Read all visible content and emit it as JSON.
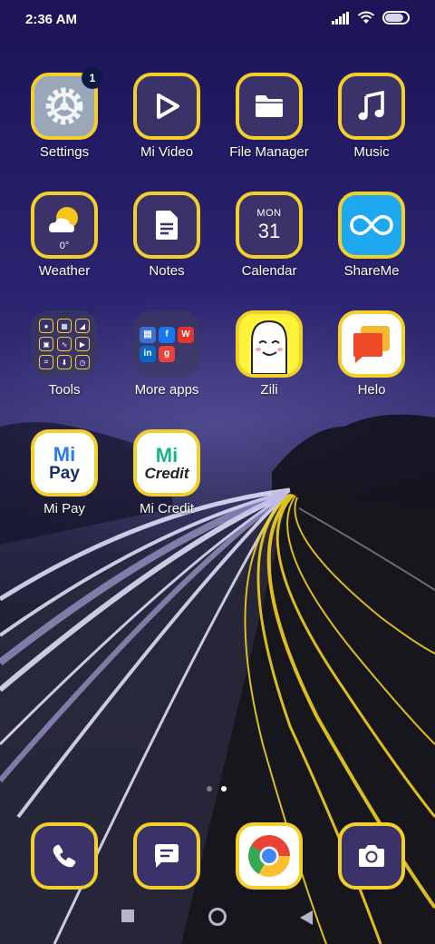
{
  "status_bar": {
    "time": "2:36 AM",
    "battery_level": 0.85
  },
  "apps": {
    "settings": {
      "label": "Settings",
      "badge": "1"
    },
    "mi_video": {
      "label": "Mi Video"
    },
    "file_manager": {
      "label": "File Manager"
    },
    "music": {
      "label": "Music"
    },
    "weather": {
      "label": "Weather",
      "temp": "0°"
    },
    "notes": {
      "label": "Notes"
    },
    "calendar": {
      "label": "Calendar",
      "month": "MON",
      "day": "31"
    },
    "shareme": {
      "label": "ShareMe"
    },
    "tools": {
      "label": "Tools"
    },
    "more_apps": {
      "label": "More apps"
    },
    "zili": {
      "label": "Zili"
    },
    "helo": {
      "label": "Helo"
    },
    "mi_pay": {
      "label": "Mi Pay",
      "logo_top": "Mi",
      "logo_bottom": "Pay"
    },
    "mi_credit": {
      "label": "Mi Credit",
      "logo_top": "Mi",
      "logo_bottom": "Credit"
    }
  },
  "pager": {
    "pages": 2,
    "current": 2
  },
  "colors": {
    "icon_border": "#f3cf2a",
    "icon_bg": "#3a3268",
    "label": "#ffffff"
  }
}
